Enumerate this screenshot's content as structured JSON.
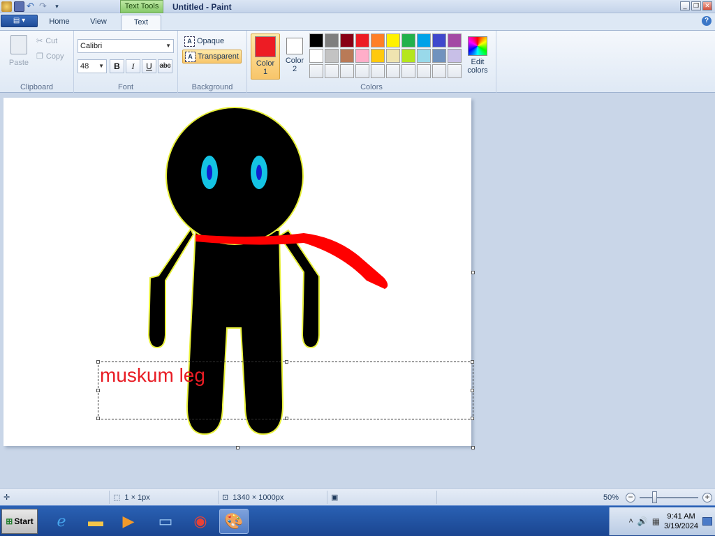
{
  "window": {
    "title": "Untitled - Paint",
    "context_tab": "Text Tools"
  },
  "tabs": [
    {
      "label": "Home"
    },
    {
      "label": "View"
    },
    {
      "label": "Text"
    }
  ],
  "clipboard": {
    "paste": "Paste",
    "cut": "Cut",
    "copy": "Copy",
    "group": "Clipboard"
  },
  "font": {
    "family": "Calibri",
    "size": "48",
    "bold": "B",
    "italic": "I",
    "underline": "U",
    "strike": "abc",
    "group": "Font"
  },
  "background": {
    "opaque": "Opaque",
    "transparent": "Transparent",
    "group": "Background"
  },
  "colors": {
    "color1_label": "Color\n1",
    "color1_line1": "Color",
    "color1_line2": "1",
    "color2_line1": "Color",
    "color2_line2": "2",
    "color1": "#ed1c24",
    "color2": "#ffffff",
    "edit_line1": "Edit",
    "edit_line2": "colors",
    "group": "Colors",
    "palette": [
      "#000000",
      "#7f7f7f",
      "#880015",
      "#ed1c24",
      "#ff7f27",
      "#fff200",
      "#22b14c",
      "#00a2e8",
      "#3f48cc",
      "#a349a4",
      "#ffffff",
      "#c3c3c3",
      "#b97a57",
      "#ffaec9",
      "#ffc90e",
      "#efe4b0",
      "#b5e61d",
      "#99d9ea",
      "#7092be",
      "#c8bfe7",
      "#ffffff",
      "#ffffff",
      "#ffffff",
      "#ffffff",
      "#ffffff",
      "#ffffff",
      "#ffffff",
      "#ffffff",
      "#ffffff",
      "#ffffff"
    ]
  },
  "canvas": {
    "text": "muskum leg"
  },
  "status": {
    "selection": "1 × 1px",
    "image_size": "1340 × 1000px",
    "zoom": "50%"
  },
  "taskbar": {
    "start": "Start",
    "time": "9:41 AM",
    "date": "3/19/2024"
  }
}
